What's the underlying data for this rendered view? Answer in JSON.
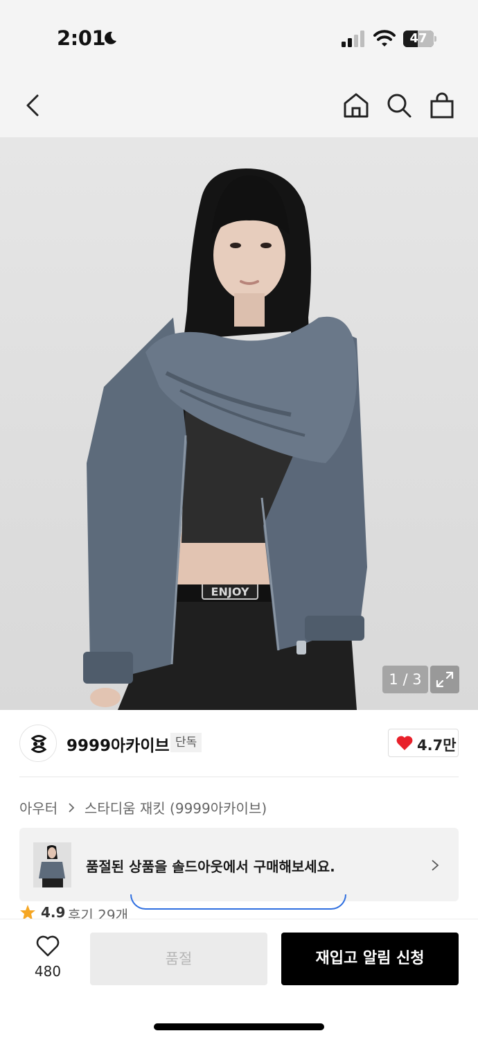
{
  "status_bar": {
    "time": "2:01",
    "battery_level": "47",
    "battery_fraction": 0.47,
    "icons": [
      "moon-icon",
      "signal-icon",
      "wifi-icon",
      "battery-icon"
    ]
  },
  "nav": {
    "icons": [
      "back-chevron-icon",
      "home-icon",
      "search-icon",
      "shopping-bag-icon"
    ]
  },
  "gallery": {
    "counter": "1 / 3",
    "current": 1,
    "total": 3,
    "belt_text": "ENJOY"
  },
  "brand": {
    "name": "9999아카이브",
    "badge": "단독",
    "likes": "4.7만"
  },
  "breadcrumb": {
    "category": "아우터",
    "product": "스타디움 재킷 (9999아카이브)"
  },
  "soldout_banner": {
    "text": "품절된 상품을 솔드아웃에서 구매해보세요."
  },
  "rating": {
    "value": "4.9",
    "reviews": "후기 29개"
  },
  "bottom": {
    "wish_count": "480",
    "soldout_label": "품절",
    "restock_label": "재입고 알림 신청"
  },
  "colors": {
    "heart": "#e8202a",
    "star": "#f5a623",
    "primary_button": "#000000",
    "disabled_button": "#ebebeb"
  }
}
